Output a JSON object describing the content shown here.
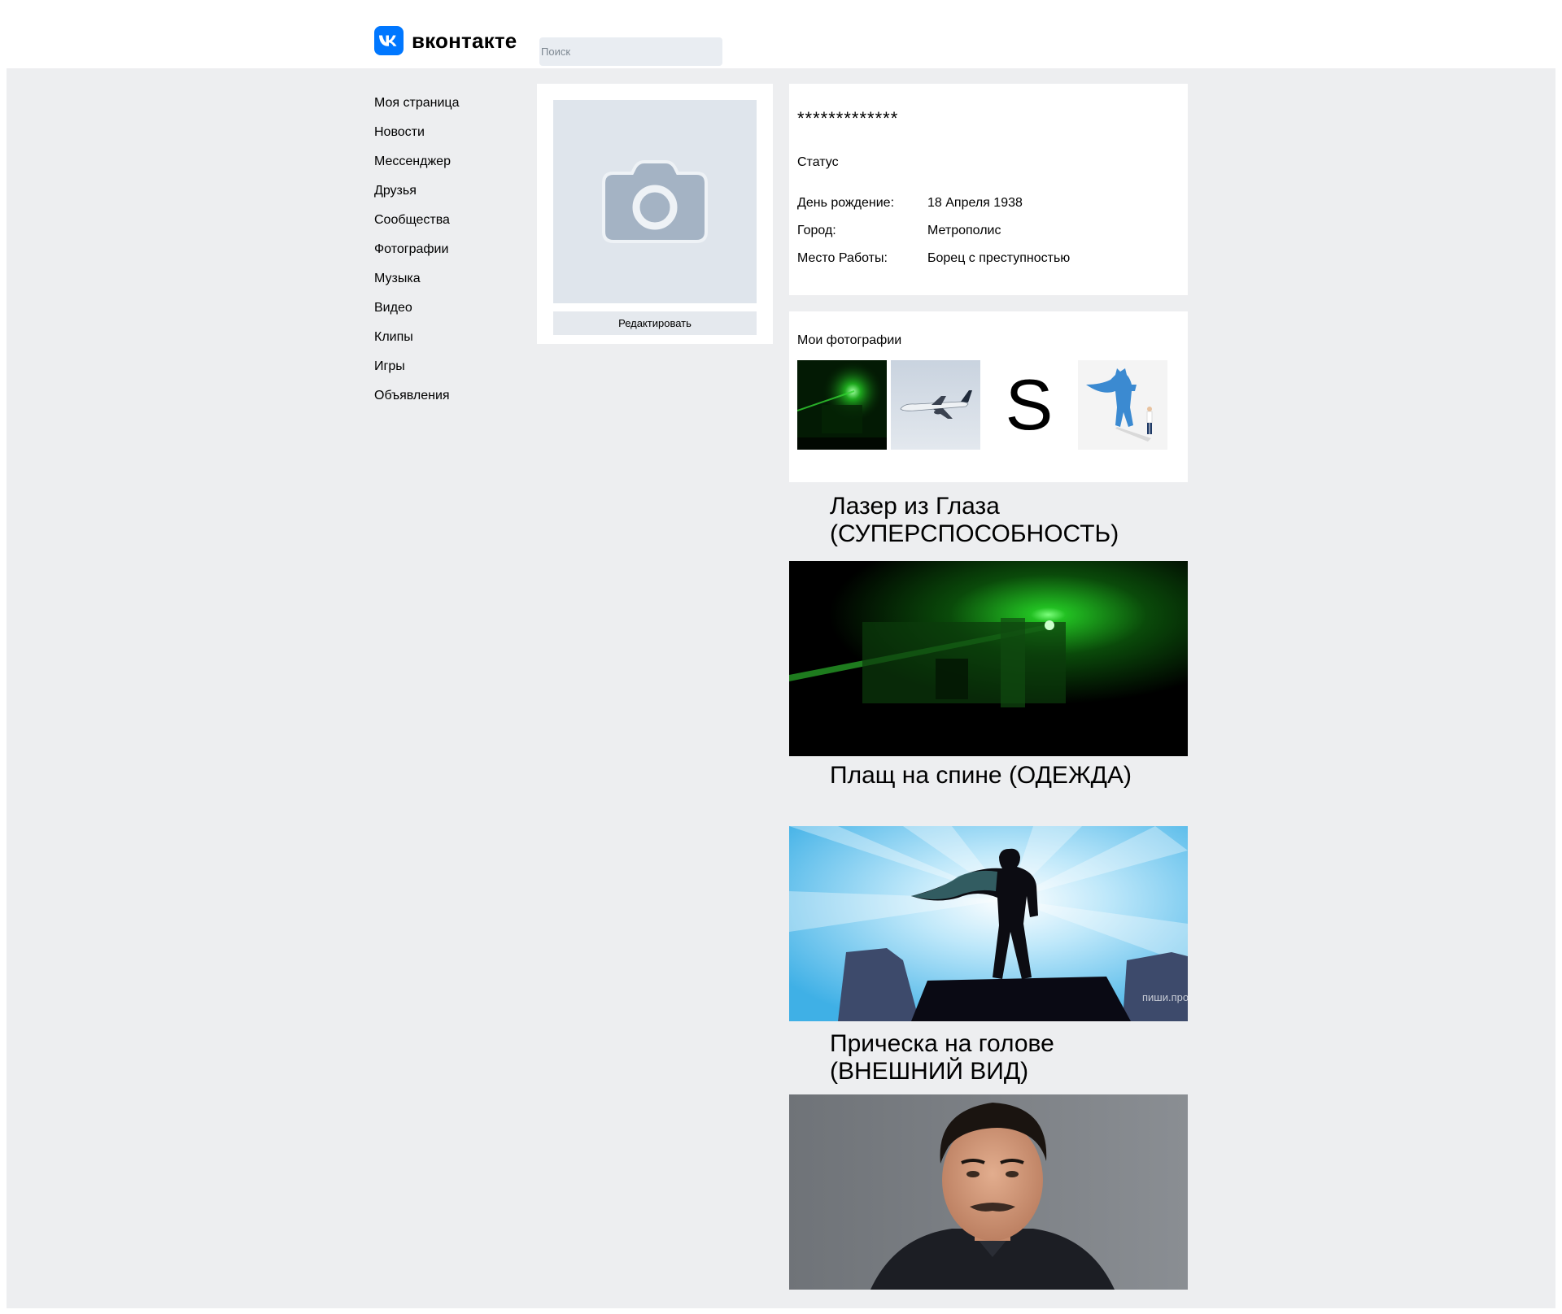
{
  "header": {
    "logo_text": "вконтакте",
    "search_placeholder": "Поиск",
    "brand_color": "#0077ff"
  },
  "sidebar": {
    "items": [
      {
        "label": "Моя страница"
      },
      {
        "label": "Новости"
      },
      {
        "label": "Мессенджер"
      },
      {
        "label": "Друзья"
      },
      {
        "label": "Сообщества"
      },
      {
        "label": "Фотографии"
      },
      {
        "label": "Музыка"
      },
      {
        "label": "Видео"
      },
      {
        "label": "Клипы"
      },
      {
        "label": "Игры"
      },
      {
        "label": "Объявления"
      }
    ]
  },
  "profile": {
    "avatar_icon": "camera-icon",
    "edit_label": "Редактировать",
    "name": "*************",
    "status": "Статус",
    "info": [
      {
        "key": "День рождение:",
        "value": "18 Апреля 1938"
      },
      {
        "key": "Город:",
        "value": "Метрополис"
      },
      {
        "key": "Место Работы:",
        "value": "Борец с преступностью"
      }
    ]
  },
  "photos": {
    "title": "Мои фотографии",
    "items": [
      {
        "name": "laser-photo"
      },
      {
        "name": "airplane-photo"
      },
      {
        "name": "s-letter-photo",
        "text": "S"
      },
      {
        "name": "superhero-shadow-photo"
      }
    ]
  },
  "posts": [
    {
      "title": "Лазер из Глаза (СУПЕРСПОСОБНОСТЬ)",
      "image": "green-laser-image"
    },
    {
      "title": "Плащ на спине (ОДЕЖДА)",
      "image": "superhero-cape-image",
      "watermark": "пиши.про"
    },
    {
      "title": "Прическа на голове (ВНЕШНИЙ ВИД)",
      "image": "man-portrait-image"
    }
  ]
}
